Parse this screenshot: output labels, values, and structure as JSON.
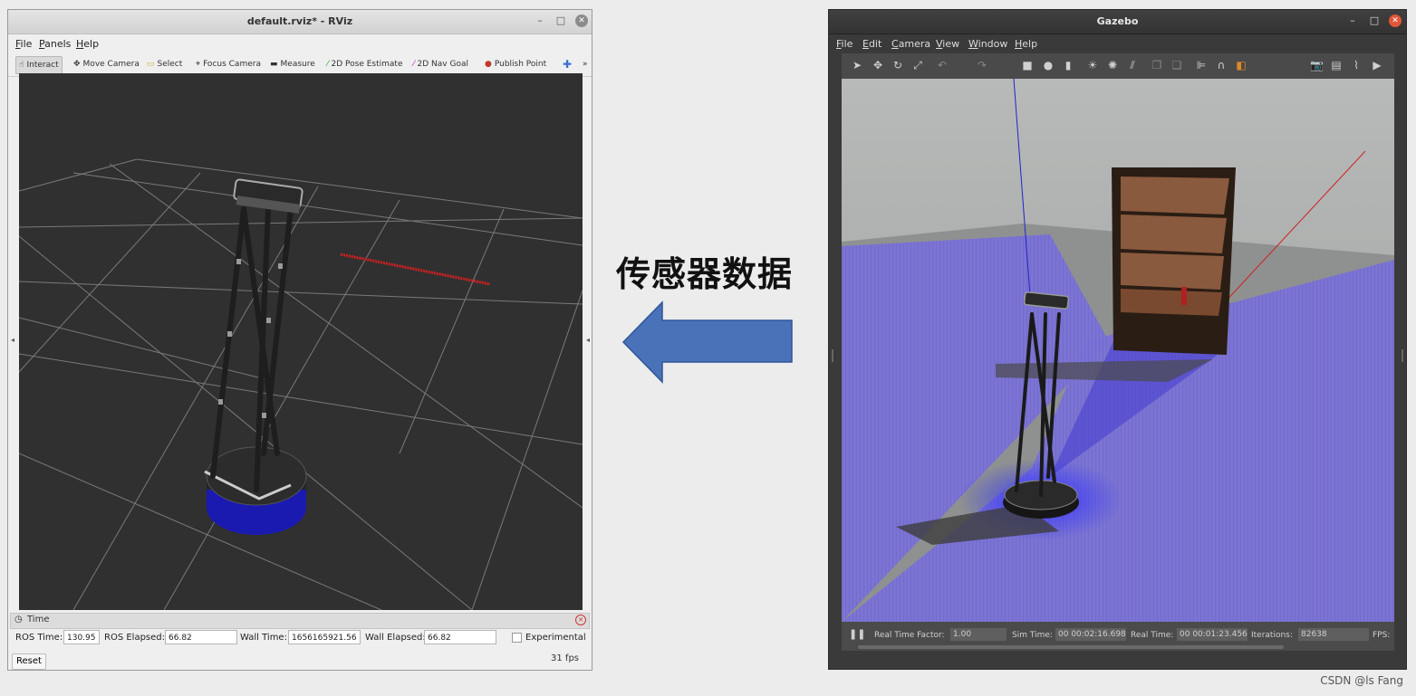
{
  "rviz": {
    "title": "default.rviz* - RViz",
    "menu": [
      "File",
      "Panels",
      "Help"
    ],
    "tools": [
      {
        "label": "Interact",
        "icon": "interact-icon",
        "glyph": "☝"
      },
      {
        "label": "Move Camera",
        "icon": "move-camera-icon",
        "glyph": "✥"
      },
      {
        "label": "Select",
        "icon": "select-icon",
        "glyph": "▭"
      },
      {
        "label": "Focus Camera",
        "icon": "focus-camera-icon",
        "glyph": "⌖"
      },
      {
        "label": "Measure",
        "icon": "measure-icon",
        "glyph": "▬"
      },
      {
        "label": "2D Pose Estimate",
        "icon": "pose-estimate-icon",
        "glyph": "⁄"
      },
      {
        "label": "2D Nav Goal",
        "icon": "nav-goal-icon",
        "glyph": "⁄"
      },
      {
        "label": "Publish Point",
        "icon": "publish-point-icon",
        "glyph": "📍"
      }
    ],
    "time_panel": {
      "header": "Time",
      "ros_time_label": "ROS Time:",
      "ros_time": "130.95",
      "ros_elapsed_label": "ROS Elapsed:",
      "ros_elapsed": "66.82",
      "wall_time_label": "Wall Time:",
      "wall_time": "1656165921.56",
      "wall_elapsed_label": "Wall Elapsed:",
      "wall_elapsed": "66.82",
      "experimental_label": "Experimental",
      "reset_label": "Reset",
      "fps": "31 fps"
    }
  },
  "middle": {
    "label": "传感器数据",
    "arrow_color": "#4a72b8"
  },
  "gazebo": {
    "title": "Gazebo",
    "menu": [
      "File",
      "Edit",
      "Camera",
      "View",
      "Window",
      "Help"
    ],
    "status": {
      "rtf_label": "Real Time Factor:",
      "rtf": "1.00",
      "sim_time_label": "Sim Time:",
      "sim_time": "00 00:02:16.698",
      "real_time_label": "Real Time:",
      "real_time": "00 00:01:23.456",
      "iterations_label": "Iterations:",
      "iterations": "82638",
      "fps_label": "FPS:"
    }
  },
  "watermark": "CSDN @ls Fang"
}
